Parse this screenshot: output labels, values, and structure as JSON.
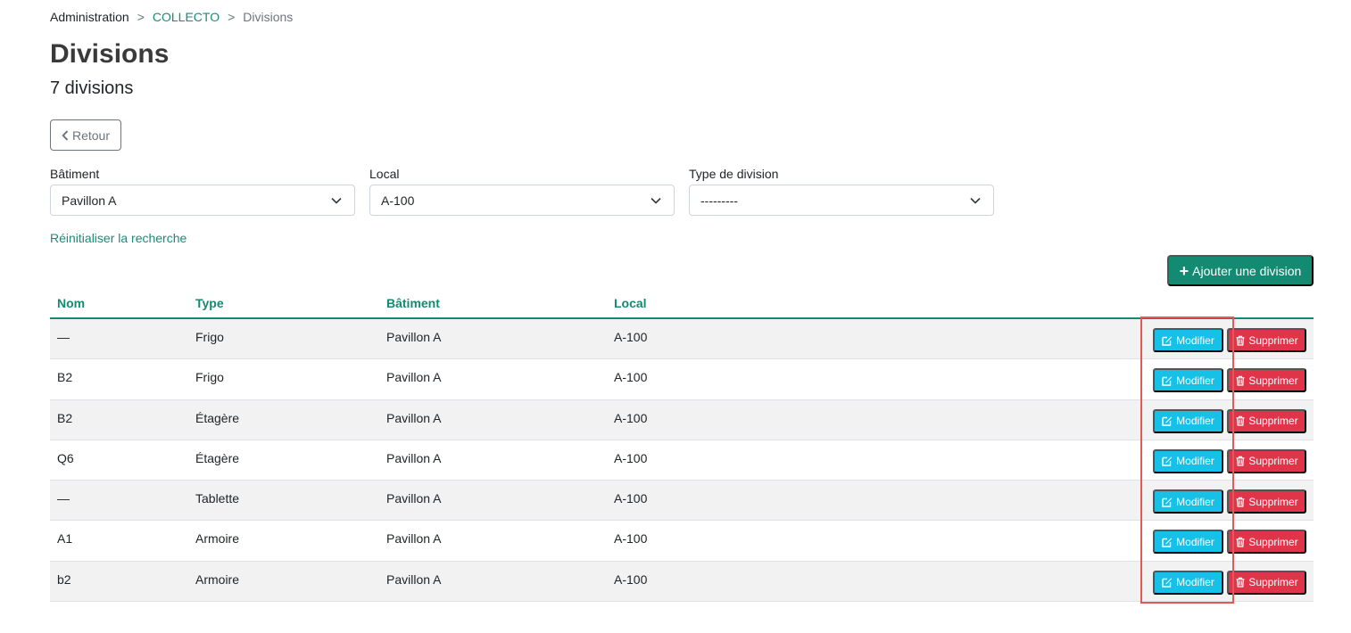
{
  "breadcrumb": {
    "root": "Administration",
    "parent": "COLLECTO",
    "current": "Divisions",
    "separator": ">"
  },
  "page": {
    "title": "Divisions",
    "count_text": "7 divisions"
  },
  "back_button": {
    "label": "Retour",
    "icon": "chevron-left-icon"
  },
  "filters": {
    "batiment": {
      "label": "Bâtiment",
      "value": "Pavillon A"
    },
    "local": {
      "label": "Local",
      "value": "A-100"
    },
    "type": {
      "label": "Type de division",
      "value": "---------"
    }
  },
  "reset_link": "Réinitialiser la recherche",
  "add_button": {
    "label": "Ajouter une division",
    "icon": "plus-icon"
  },
  "table": {
    "headers": {
      "nom": "Nom",
      "type": "Type",
      "batiment": "Bâtiment",
      "local": "Local"
    },
    "rows": [
      {
        "nom": "—",
        "type": "Frigo",
        "batiment": "Pavillon A",
        "local": "A-100"
      },
      {
        "nom": "B2",
        "type": "Frigo",
        "batiment": "Pavillon A",
        "local": "A-100"
      },
      {
        "nom": "B2",
        "type": "Étagère",
        "batiment": "Pavillon A",
        "local": "A-100"
      },
      {
        "nom": "Q6",
        "type": "Étagère",
        "batiment": "Pavillon A",
        "local": "A-100"
      },
      {
        "nom": "—",
        "type": "Tablette",
        "batiment": "Pavillon A",
        "local": "A-100"
      },
      {
        "nom": "A1",
        "type": "Armoire",
        "batiment": "Pavillon A",
        "local": "A-100"
      },
      {
        "nom": "b2",
        "type": "Armoire",
        "batiment": "Pavillon A",
        "local": "A-100"
      }
    ],
    "actions": {
      "edit_label": "Modifier",
      "delete_label": "Supprimer"
    }
  },
  "colors": {
    "primary_green": "#138a72",
    "link_teal": "#1a8a7a",
    "edit_cyan": "#17c0e6",
    "delete_red": "#e0344a",
    "highlight_red": "#e05a5a"
  }
}
